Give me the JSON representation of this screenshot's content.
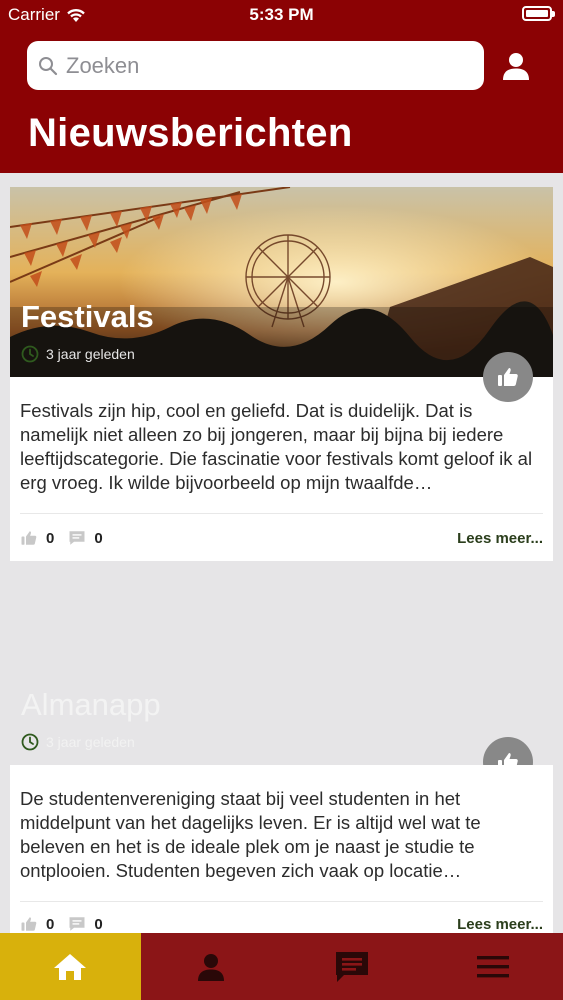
{
  "status_bar": {
    "carrier": "Carrier",
    "time": "5:33 PM"
  },
  "search": {
    "placeholder": "Zoeken"
  },
  "header": {
    "title": "Nieuwsberichten"
  },
  "articles": [
    {
      "title": "Festivals",
      "time": "3 jaar geleden",
      "excerpt": "Festivals zijn hip, cool en geliefd. Dat is duidelijk. Dat is namelijk niet alleen zo bij jongeren, maar bij bijna bij iedere leeftijdscategorie. Die fascinatie voor festivals komt geloof ik al erg vroeg. Ik wilde bijvoorbeeld op mijn twaalfde…",
      "likes": "0",
      "comments": "0",
      "read_more": "Lees meer..."
    },
    {
      "title": "Almanapp",
      "time": "3 jaar geleden",
      "excerpt": "De studentenvereniging staat bij veel studenten in het middelpunt van het dagelijks leven. Er is altijd wel wat te beleven en het is de ideale plek om je naast je studie te ontplooien. Studenten begeven zich vaak op locatie…",
      "likes": "0",
      "comments": "0",
      "read_more": "Lees meer..."
    }
  ],
  "tab_bar": {
    "tabs": [
      {
        "icon": "home-icon",
        "active": true
      },
      {
        "icon": "person-icon",
        "active": false
      },
      {
        "icon": "chat-icon",
        "active": false
      },
      {
        "icon": "menu-icon",
        "active": false
      }
    ]
  },
  "colors": {
    "brand_red": "#8b0204",
    "tab_bar": "#8b1517",
    "tab_active": "#d8b10c",
    "read_more": "#2b3e1c",
    "background": "#e6e5e7"
  }
}
